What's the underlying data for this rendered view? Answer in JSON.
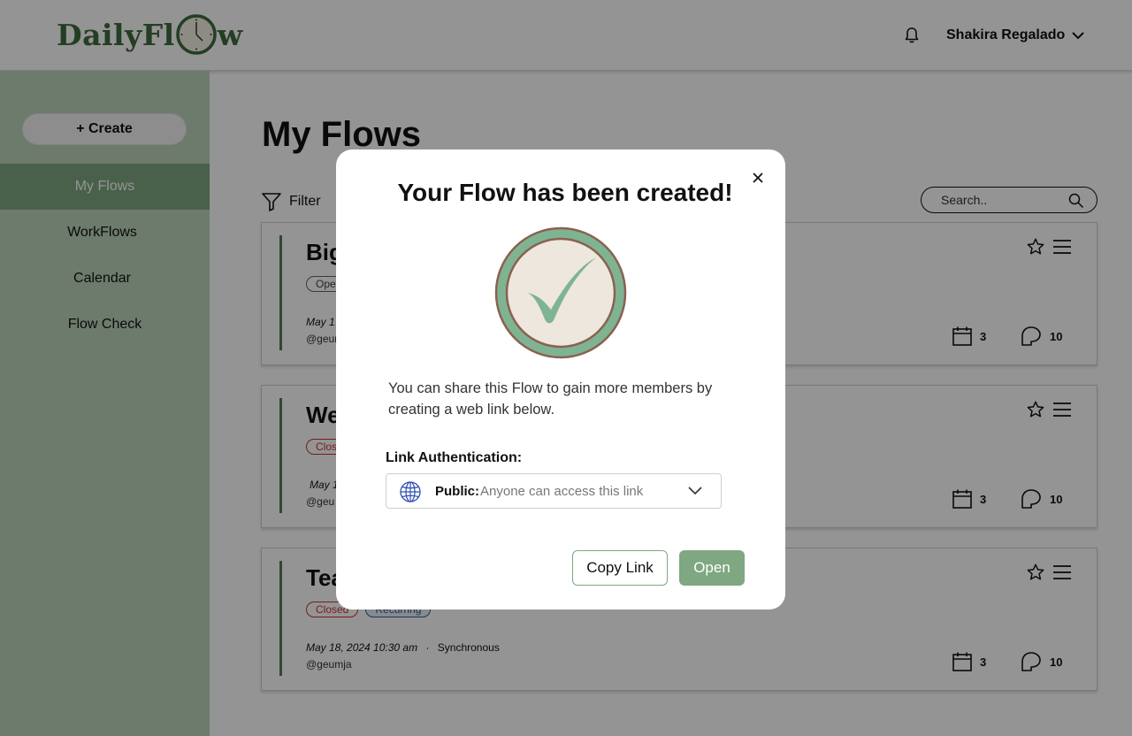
{
  "app": {
    "logo_text_left": "DailyFl",
    "logo_text_right": "w",
    "user_name": "Shakira Regalado",
    "brand_color": "#3f6b3d",
    "accent_color": "#7fa781",
    "sidebar_color": "#bcd4bb"
  },
  "sidebar": {
    "create_label": "+ Create",
    "items": [
      {
        "label": "My Flows",
        "active": true
      },
      {
        "label": "WorkFlows",
        "active": false
      },
      {
        "label": "Calendar",
        "active": false
      },
      {
        "label": "Flow Check",
        "active": false
      }
    ]
  },
  "main": {
    "title": "My Flows",
    "filter_label": "Filter",
    "search_placeholder": "Search..",
    "cards": [
      {
        "title": "Big",
        "tags": [
          "Ope"
        ],
        "date": "May 1",
        "handle": "@geum",
        "calendar_count": "3",
        "comment_count": "10"
      },
      {
        "title": "We",
        "tags": [
          "Clos"
        ],
        "date": "May 1",
        "handle": "@geu",
        "calendar_count": "3",
        "comment_count": "10"
      },
      {
        "title": "Tea",
        "tags": [
          "Closed",
          "Recurring"
        ],
        "date": "May 18, 2024 10:30 am",
        "separator": "·",
        "mode": "Synchronous",
        "handle": "@geumja",
        "calendar_count": "3",
        "comment_count": "10"
      }
    ]
  },
  "modal": {
    "title": "Your Flow has been created!",
    "description": "You can share this Flow to gain more members by creating a web link below.",
    "auth_label": "Link Authentication:",
    "visibility_value": "Public:",
    "visibility_desc": "Anyone can access this link",
    "copy_label": "Copy Link",
    "open_label": "Open",
    "icons": [
      "close-icon",
      "check-badge-icon",
      "globe-icon",
      "chevron-down-icon"
    ]
  }
}
